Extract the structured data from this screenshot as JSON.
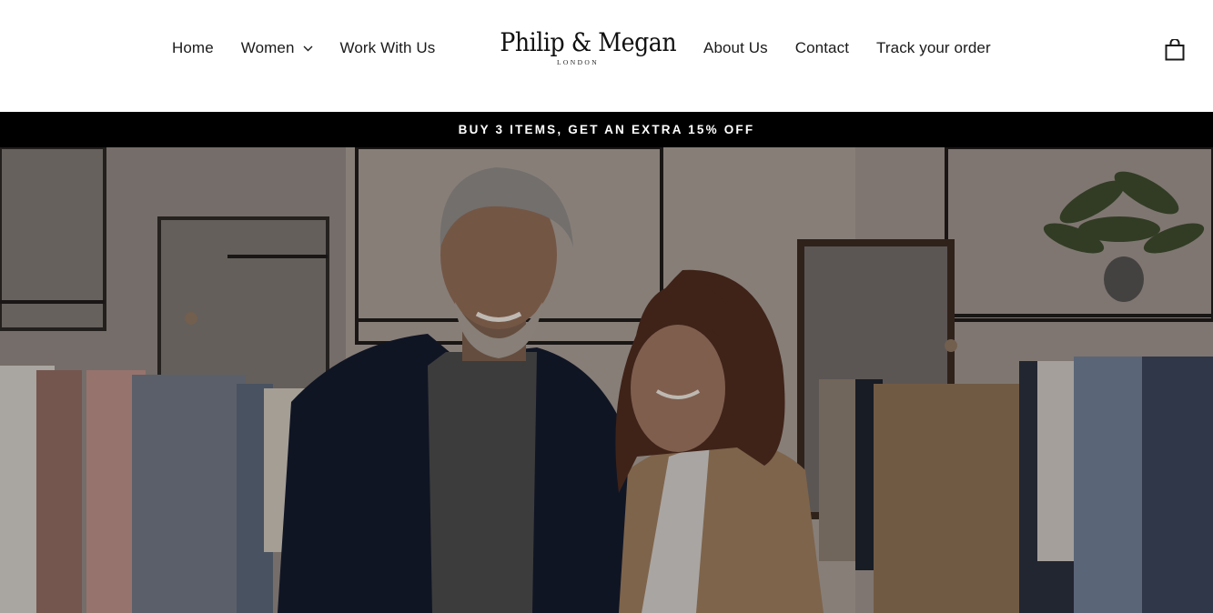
{
  "header": {
    "nav_left": [
      {
        "label": "Home"
      },
      {
        "label": "Women",
        "has_dropdown": true
      },
      {
        "label": "Work With Us"
      }
    ],
    "logo": {
      "name": "Philip & Megan",
      "tagline": "LONDON"
    },
    "nav_right": [
      {
        "label": "About Us"
      },
      {
        "label": "Contact"
      },
      {
        "label": "Track your order"
      }
    ],
    "cart_icon": "shopping-bag-icon"
  },
  "announcement": {
    "text": "BUY 3 ITEMS, GET AN EXTRA 15% OFF"
  },
  "hero": {
    "image": "couple-in-clothing-store-photo",
    "overlay": "dark"
  },
  "colors": {
    "announcement_bg": "#000000",
    "announcement_text": "#ffffff",
    "nav_text": "#1a1a1a"
  }
}
